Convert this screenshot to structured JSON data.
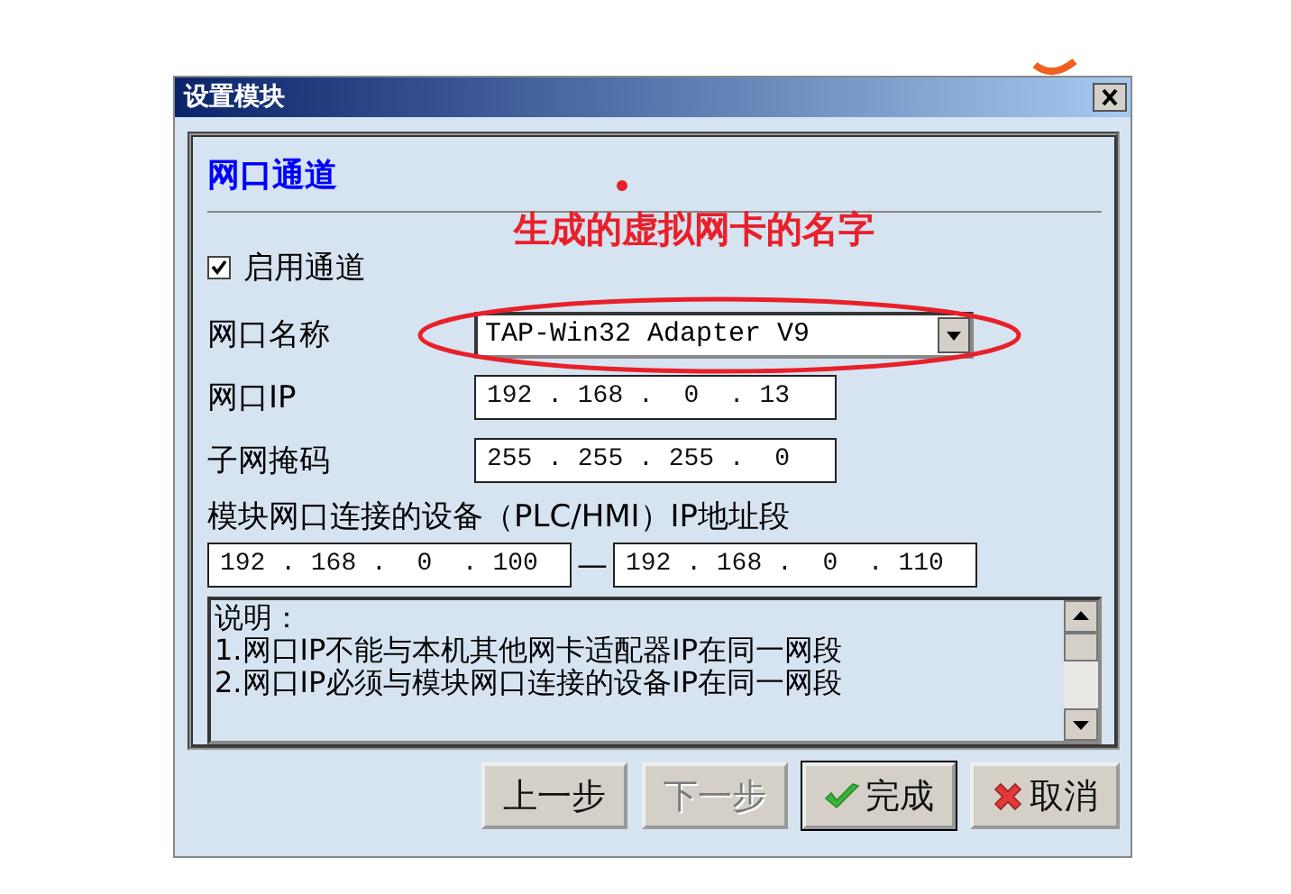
{
  "window": {
    "title": "设置模块"
  },
  "section": {
    "title": "网口通道"
  },
  "enable": {
    "label": "启用通道",
    "checked": true
  },
  "fields": [
    {
      "kind": "select",
      "label": "网口名称",
      "value": "TAP-Win32 Adapter V9"
    },
    {
      "kind": "ip",
      "label": "网口IP",
      "value": "192 . 168 .  0  . 13"
    },
    {
      "kind": "ip",
      "label": "子网掩码",
      "value": "255 . 255 . 255 .  0"
    }
  ],
  "range": {
    "label": "模块网口连接的设备（PLC/HMI）IP地址段",
    "from": "192 . 168 .  0  . 100",
    "separator": "—",
    "to": "192 . 168 .  0  . 110"
  },
  "notes": {
    "lines": [
      "说明：",
      "1.网口IP不能与本机其他网卡适配器IP在同一网段",
      "2.网口IP必须与模块网口连接的设备IP在同一网段"
    ]
  },
  "buttons": [
    {
      "kind": "back",
      "label": "上一步",
      "disabled": false
    },
    {
      "kind": "next",
      "label": "下一步",
      "disabled": true
    },
    {
      "kind": "finish",
      "label": "完成",
      "disabled": false
    },
    {
      "kind": "cancel",
      "label": "取消",
      "disabled": false
    }
  ],
  "annotation": {
    "text": "生成的虚拟网卡的名字"
  }
}
